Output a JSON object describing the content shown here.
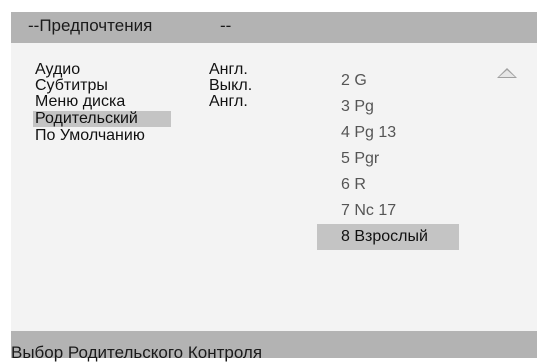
{
  "header": {
    "title": "--Предпочтения",
    "trailing": "--"
  },
  "menu": {
    "items": [
      {
        "label": "Аудио",
        "value": "Англ."
      },
      {
        "label": "Субтитры",
        "value": "Выкл."
      },
      {
        "label": "Меню диска",
        "value": "Англ."
      },
      {
        "label": "Родительский",
        "value": ""
      },
      {
        "label": "По Умолчанию",
        "value": ""
      }
    ],
    "selected": "Родительский"
  },
  "ratings": {
    "items": [
      "2 G",
      "3 Pg",
      "4 Pg 13",
      "5 Pgr",
      "6 R",
      "7 Nc 17",
      "8 Взрослый"
    ],
    "selected": "8 Взрослый",
    "scroll_icon": "triangle-up-icon"
  },
  "status": {
    "text": "Выбор Родительского Контроля"
  },
  "colors": {
    "bar": "#b3b3b3",
    "background": "#f3f3f3",
    "highlight": "#c4c4c4"
  }
}
